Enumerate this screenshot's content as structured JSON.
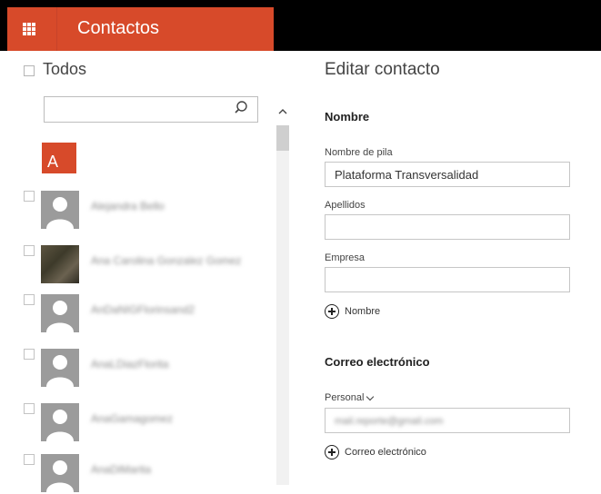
{
  "app": {
    "title": "Contactos",
    "header_icon": "waffle-app-launcher-icon",
    "brand_color": "#d74a2a"
  },
  "list": {
    "select_all_label": "Todos",
    "search_placeholder": "",
    "letter_group": "A",
    "contacts": [
      {
        "name": "Alejandra Bello",
        "avatar": "person-icon"
      },
      {
        "name": "Ana Carolina Gonzalez Gomez",
        "avatar": "photo"
      },
      {
        "name": "AnDaNIGFlorinsand2",
        "avatar": "person-icon"
      },
      {
        "name": "AnaLDiazFlorita",
        "avatar": "person-icon"
      },
      {
        "name": "AnaGamagomez",
        "avatar": "person-icon"
      },
      {
        "name": "AnaDiMarita",
        "avatar": "person-icon"
      }
    ]
  },
  "editor": {
    "title": "Editar contacto",
    "name_section": "Nombre",
    "first_name_label": "Nombre de pila",
    "first_name_value": "Plataforma Transversalidad",
    "last_name_label": "Apellidos",
    "last_name_value": "",
    "company_label": "Empresa",
    "company_value": "",
    "add_name_label": "Nombre",
    "email_section": "Correo electrónico",
    "email_type": "Personal",
    "email_value": "mail.reporte@gmail.com",
    "add_email_label": "Correo electrónico"
  }
}
